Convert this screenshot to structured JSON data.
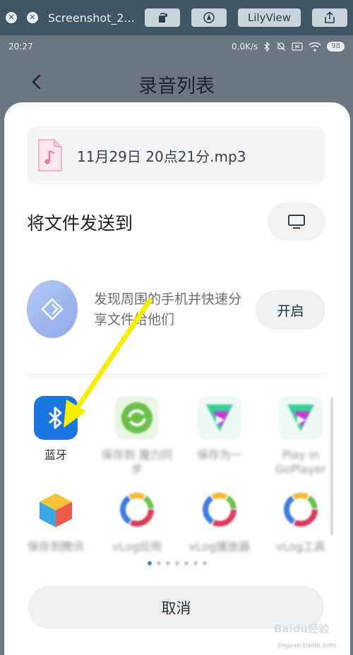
{
  "viewer": {
    "title": "Screenshot_2...",
    "lilyview_label": "LilyView",
    "close_glyph": "✕",
    "minimize_glyph": "✕"
  },
  "status": {
    "time": "20:27",
    "speed": "0.0K/s",
    "battery": "98"
  },
  "header": {
    "title": "录音列表"
  },
  "file": {
    "name": "11月29日 20点21分.mp3",
    "icon": "music-file-icon",
    "accent": "#e77a9a"
  },
  "send": {
    "title": "将文件发送到"
  },
  "share": {
    "text": "发现周围的手机并快速分享文件给他们",
    "open_label": "开启"
  },
  "apps": [
    {
      "label": "蓝牙",
      "icon": "bluetooth-icon",
      "color": "#1a76e0",
      "blurred": false
    },
    {
      "label": "保存到 魔力同步",
      "icon": "sync-icon",
      "color": "#6cc04a",
      "blurred": true
    },
    {
      "label": "保存为一",
      "icon": "player-icon",
      "color": "#3ccf95",
      "blurred": true
    },
    {
      "label": "Play in GoPlayer",
      "icon": "player-icon",
      "color": "#3ccf95",
      "blurred": true
    },
    {
      "label": "保存到腾讯",
      "icon": "cube-icon",
      "color": "#f3b63a",
      "blurred": true
    },
    {
      "label": "vLog应用",
      "icon": "ring-icon",
      "color": "#d93a55",
      "blurred": true
    },
    {
      "label": "vLog播放器",
      "icon": "ring-icon",
      "color": "#d93a55",
      "blurred": true
    },
    {
      "label": "vLog工具",
      "icon": "ring-icon",
      "color": "#d93a55",
      "blurred": true
    }
  ],
  "pagination": {
    "count": 7,
    "active": 0
  },
  "cancel_label": "取消",
  "watermark": {
    "brand": "Baidu经验",
    "sub": "jingyan.baidu.com"
  },
  "colors": {
    "accent_blue": "#2d8ef0",
    "arrow": "#f6f000"
  }
}
